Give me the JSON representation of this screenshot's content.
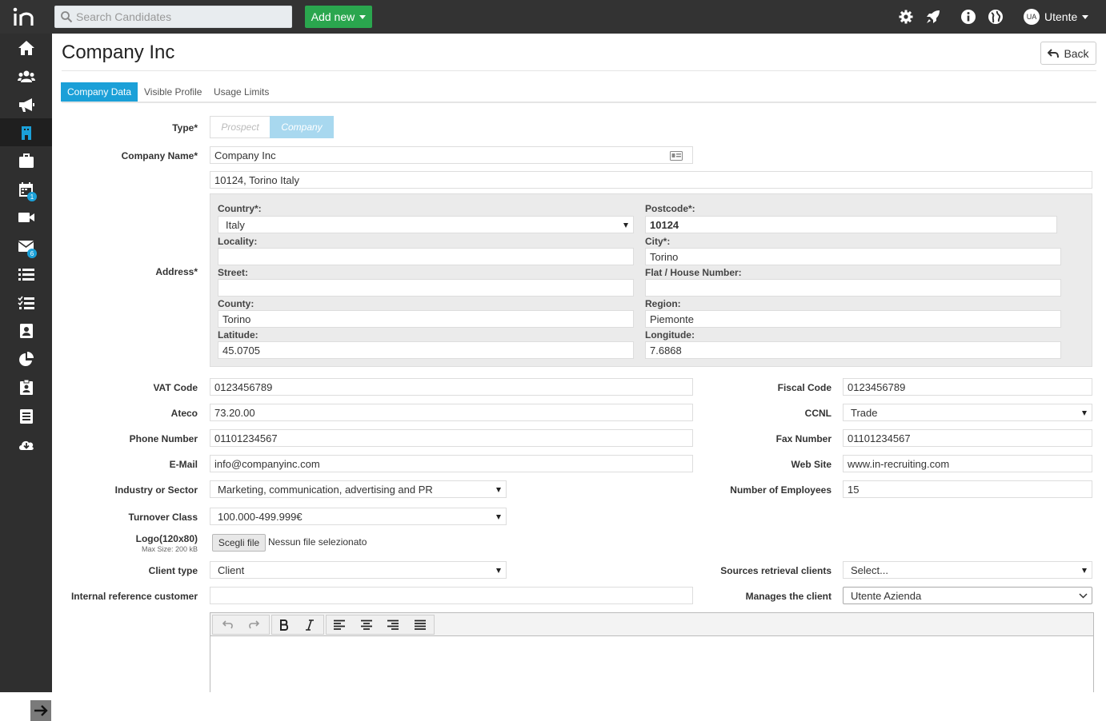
{
  "topbar": {
    "search_placeholder": "Search Candidates",
    "add_new_label": "Add new",
    "user_initials": "UA",
    "user_name": "Utente"
  },
  "sidebar": {
    "items": [
      {
        "icon": "home-icon"
      },
      {
        "icon": "users-icon"
      },
      {
        "icon": "megaphone-icon"
      },
      {
        "icon": "company-icon",
        "active": true
      },
      {
        "icon": "briefcase-icon"
      },
      {
        "icon": "calendar-icon",
        "badge": "1"
      },
      {
        "icon": "video-icon"
      },
      {
        "icon": "mail-icon",
        "badge": "6"
      },
      {
        "icon": "list-icon"
      },
      {
        "icon": "checklist-icon"
      },
      {
        "icon": "contact-card-icon"
      },
      {
        "icon": "pie-chart-icon"
      },
      {
        "icon": "clipboard-user-icon"
      },
      {
        "icon": "document-icon"
      },
      {
        "icon": "cloud-download-icon"
      }
    ]
  },
  "page": {
    "title": "Company Inc",
    "back_label": "Back"
  },
  "tabs": [
    "Company Data",
    "Visible Profile",
    "Usage Limits"
  ],
  "form": {
    "type_label": "Type*",
    "type_options": [
      "Prospect",
      "Company"
    ],
    "company_name_label": "Company Name*",
    "company_name": "Company Inc",
    "address_label": "Address*",
    "address_summary": "10124, Torino Italy",
    "address": {
      "country_label": "Country*:",
      "country": "Italy",
      "postcode_label": "Postcode*:",
      "postcode": "10124",
      "locality_label": "Locality:",
      "locality": "",
      "city_label": "City*:",
      "city": "Torino",
      "street_label": "Street:",
      "street": "",
      "flat_label": "Flat / House Number:",
      "flat": "",
      "county_label": "County:",
      "county": "Torino",
      "region_label": "Region:",
      "region": "Piemonte",
      "latitude_label": "Latitude:",
      "latitude": "45.0705",
      "longitude_label": "Longitude:",
      "longitude": "7.6868"
    },
    "vat_label": "VAT Code",
    "vat": "0123456789",
    "fiscal_label": "Fiscal Code",
    "fiscal": "0123456789",
    "ateco_label": "Ateco",
    "ateco": "73.20.00",
    "ccnl_label": "CCNL",
    "ccnl": "Trade",
    "phone_label": "Phone Number",
    "phone": "01101234567",
    "fax_label": "Fax Number",
    "fax": "01101234567",
    "email_label": "E-Mail",
    "email": "info@companyinc.com",
    "website_label": "Web Site",
    "website": "www.in-recruiting.com",
    "industry_label": "Industry or Sector",
    "industry": "Marketing, communication, advertising and PR",
    "employees_label": "Number of Employees",
    "employees": "15",
    "turnover_label": "Turnover Class",
    "turnover": "100.000-499.999€",
    "logo_label": "Logo(120x80)",
    "logo_maxsize": "Max Size: 200 kB",
    "file_button": "Scegli file",
    "file_status": "Nessun file selezionato",
    "client_type_label": "Client type",
    "client_type": "Client",
    "sources_label": "Sources retrieval clients",
    "sources": "Select...",
    "internal_ref_label": "Internal reference customer",
    "internal_ref": "",
    "manages_label": "Manages the client",
    "manages": "Utente Azienda"
  },
  "editor": {
    "buttons": [
      "undo-icon",
      "redo-icon",
      "bold-icon",
      "italic-icon",
      "align-left-icon",
      "align-center-icon",
      "align-right-icon",
      "align-justify-icon"
    ]
  },
  "colors": {
    "topbar": "#333333",
    "sidebar": "#2f2f2f",
    "accent": "#1ba0d8",
    "add_new": "#2aa64e",
    "toggle_active": "#a8d8ef"
  }
}
